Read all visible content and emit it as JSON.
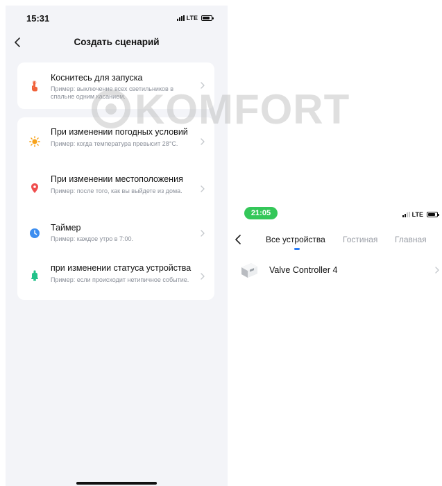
{
  "left_screen": {
    "status_bar": {
      "time": "15:31",
      "network": "LTE"
    },
    "header": {
      "title": "Создать сценарий"
    },
    "groups": [
      [
        {
          "icon": "tap-hand-icon",
          "title": "Коснитесь для запуска",
          "desc": "Пример: выключение всех светильников в спальне одним касанием."
        }
      ],
      [
        {
          "icon": "sun-icon",
          "title": "При изменении погодных условий",
          "desc": "Пример: когда температура превысит 28°C."
        },
        {
          "icon": "location-pin-icon",
          "title": "При изменении местоположения",
          "desc": "Пример: после того, как вы выйдете из дома."
        },
        {
          "icon": "clock-icon",
          "title": "Таймер",
          "desc": "Пример: каждое утро в 7:00."
        },
        {
          "icon": "device-status-icon",
          "title": "при изменении статуса устройства",
          "desc": "Пример: если происходит нетипичное событие."
        }
      ]
    ]
  },
  "watermark": {
    "text": "KOMFORT"
  },
  "right_screen": {
    "status_bar": {
      "time": "21:05",
      "network": "LTE"
    },
    "tabs": [
      {
        "label": "Все устройства",
        "active": true
      },
      {
        "label": "Гостиная",
        "active": false
      },
      {
        "label": "Главная",
        "active": false
      }
    ],
    "devices": [
      {
        "name": "Valve Controller 4",
        "icon": "valve-controller-icon"
      }
    ]
  },
  "colors": {
    "accent": "#2a7cf6",
    "tap_orange": "#f0623a",
    "sun_orange": "#f7a21a",
    "pin_red": "#ef4e4e",
    "clock_blue": "#3d8ef0",
    "device_green": "#22c28a",
    "status_green": "#34c759"
  }
}
